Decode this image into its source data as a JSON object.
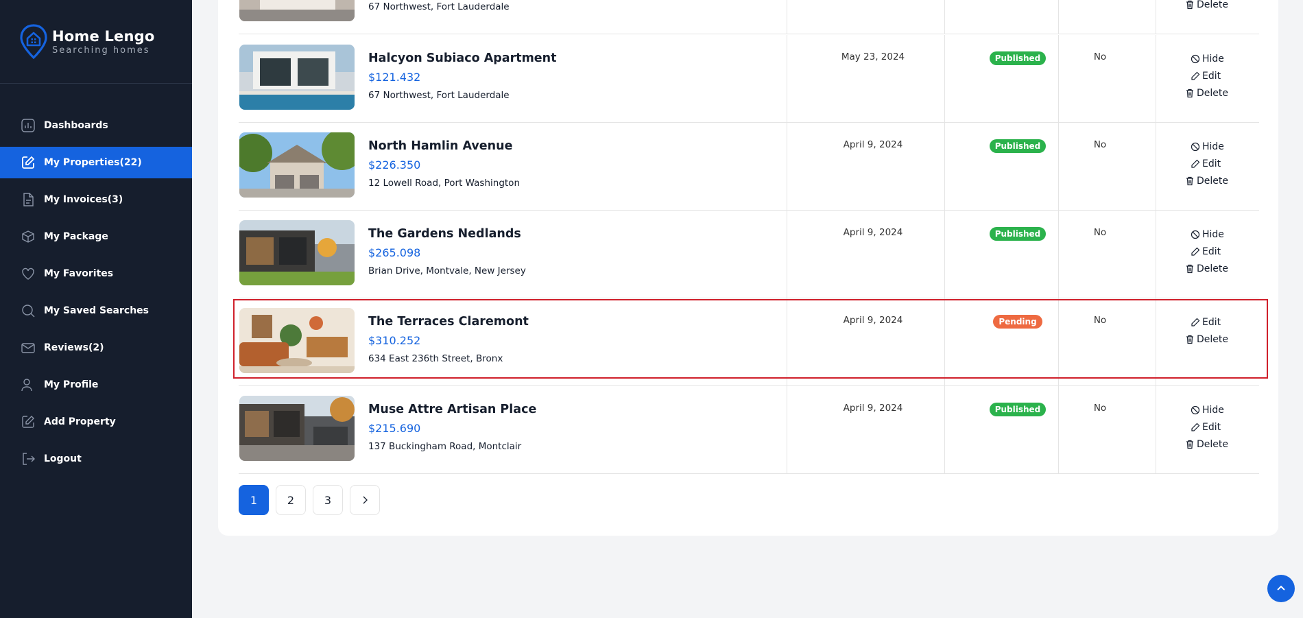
{
  "brand": {
    "title": "Home Lengo",
    "subtitle": "Searching homes",
    "accent": "#1563df"
  },
  "sidebar": {
    "items": [
      {
        "label": "Dashboards",
        "icon": "chart-icon"
      },
      {
        "label": "My Properties(22)",
        "icon": "edit-square-icon",
        "active": true
      },
      {
        "label": "My Invoices(3)",
        "icon": "document-icon"
      },
      {
        "label": "My Package",
        "icon": "package-icon"
      },
      {
        "label": "My Favorites",
        "icon": "heart-icon"
      },
      {
        "label": "My Saved Searches",
        "icon": "search-icon"
      },
      {
        "label": "Reviews(2)",
        "icon": "mail-icon"
      },
      {
        "label": "My Profile",
        "icon": "user-icon"
      },
      {
        "label": "Add Property",
        "icon": "add-edit-icon"
      },
      {
        "label": "Logout",
        "icon": "logout-icon"
      }
    ]
  },
  "properties": [
    {
      "title": "",
      "price": "",
      "address": "67 Northwest, Fort Lauderdale",
      "date": "",
      "status": "",
      "featured": "",
      "actions": [
        "Delete"
      ]
    },
    {
      "title": "Halcyon Subiaco Apartment",
      "price": "$121.432",
      "address": "67 Northwest, Fort Lauderdale",
      "date": "May 23, 2024",
      "status": "Published",
      "featured": "No",
      "actions": [
        "Hide",
        "Edit",
        "Delete"
      ]
    },
    {
      "title": "North Hamlin Avenue",
      "price": "$226.350",
      "address": "12 Lowell Road, Port Washington",
      "date": "April 9, 2024",
      "status": "Published",
      "featured": "No",
      "actions": [
        "Hide",
        "Edit",
        "Delete"
      ]
    },
    {
      "title": "The Gardens Nedlands",
      "price": "$265.098",
      "address": "Brian Drive, Montvale, New Jersey",
      "date": "April 9, 2024",
      "status": "Published",
      "featured": "No",
      "actions": [
        "Hide",
        "Edit",
        "Delete"
      ]
    },
    {
      "title": "The Terraces Claremont",
      "price": "$310.252",
      "address": "634 East 236th Street, Bronx",
      "date": "April 9, 2024",
      "status": "Pending",
      "featured": "No",
      "actions": [
        "Edit",
        "Delete"
      ]
    },
    {
      "title": "Muse Attre Artisan Place",
      "price": "$215.690",
      "address": "137 Buckingham Road, Montclair",
      "date": "April 9, 2024",
      "status": "Published",
      "featured": "No",
      "actions": [
        "Hide",
        "Edit",
        "Delete"
      ]
    }
  ],
  "pagination": {
    "pages": [
      "1",
      "2",
      "3"
    ],
    "current": "1"
  },
  "colors": {
    "published": "#2bb24c",
    "pending": "#ee6a41",
    "highlight": "#d0202b",
    "sidebar_bg": "#161e2d"
  }
}
